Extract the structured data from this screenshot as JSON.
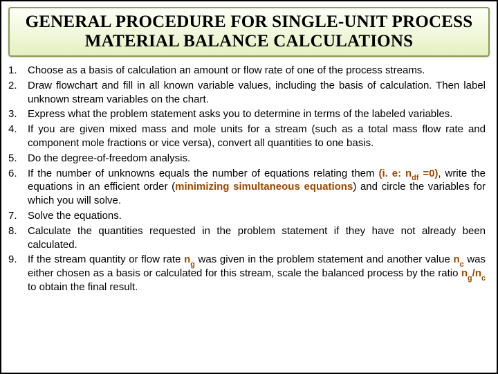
{
  "title": "GENERAL PROCEDURE FOR SINGLE-UNIT PROCESS MATERIAL BALANCE CALCULATIONS",
  "items": [
    {
      "n": "1.",
      "text": "Choose as a basis of calculation an amount or flow rate of one of the process streams."
    },
    {
      "n": "2.",
      "text": "Draw flowchart and fill in all known variable values, including the basis of calculation. Then label unknown stream variables on the chart."
    },
    {
      "n": "3.",
      "text": "Express what the problem statement asks you to determine in terms of the labeled variables."
    },
    {
      "n": "4.",
      "text": "If you are given mixed mass and mole units for a stream (such as a total mass flow rate and component mole fractions or vice versa), convert all quantities to one basis."
    },
    {
      "n": "5.",
      "text": "Do the degree-of-freedom analysis."
    },
    {
      "n": "6.",
      "pre": "If the number of unknowns equals the number of equations relating them ",
      "hl1": "(i. e: n",
      "sub1": "df",
      "hl1b": " =0)",
      "mid": ", write the equations in an efficient order (",
      "hl2": "minimizing simultaneous equations",
      "post": ") and circle the variables for which you will solve."
    },
    {
      "n": "7.",
      "text": "Solve the equations."
    },
    {
      "n": "8.",
      "text": "Calculate the quantities requested in the problem statement if they have not already been calculated."
    },
    {
      "n": "9.",
      "p9a": "If the stream quantity or flow rate ",
      "p9n1": "n",
      "p9s1": "g",
      "p9b": " was given in the problem statement and another value ",
      "p9n2": "n",
      "p9s2": "c",
      "p9c": " was either chosen as a basis or calculated for this stream, scale the balanced process by the ratio ",
      "p9n3": "n",
      "p9s3": "g",
      "p9sl": "/",
      "p9n4": "n",
      "p9s4": "c",
      "p9d": " to obtain the final result."
    }
  ]
}
